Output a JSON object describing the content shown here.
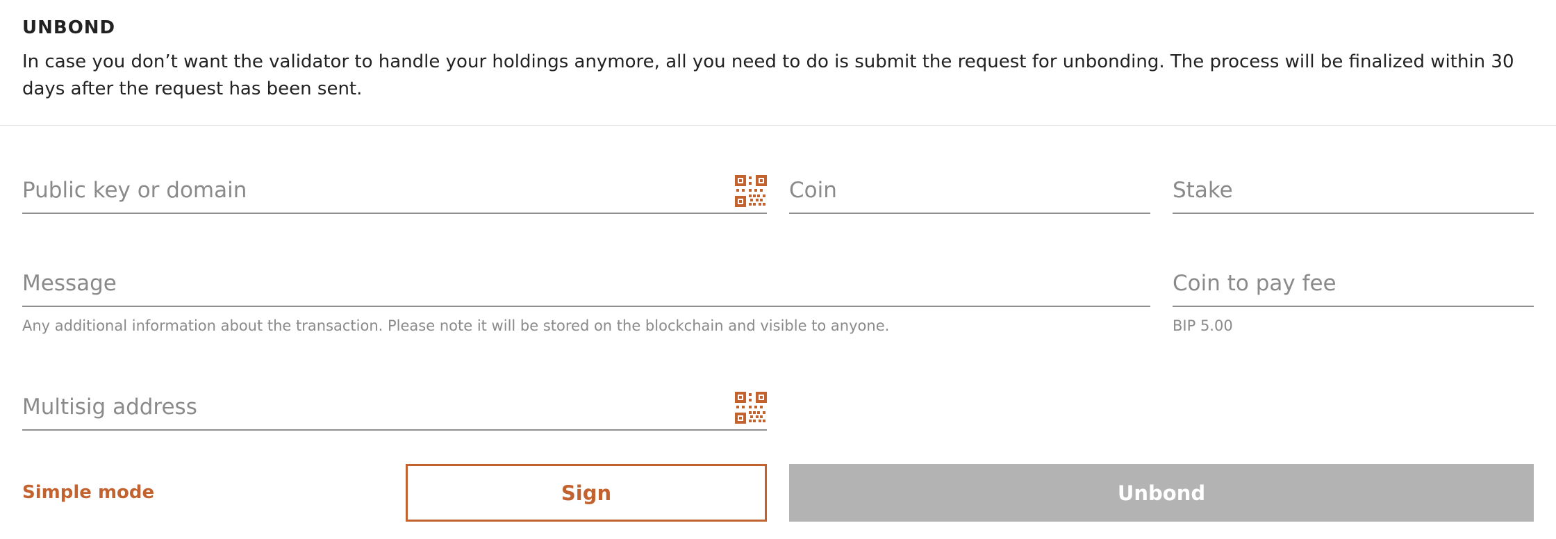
{
  "header": {
    "title": "UNBOND",
    "description": "In case you don’t want the validator to handle your holdings anymore, all you need to do is submit the request for unbonding. The process will be finalized within 30 days after the request has been sent."
  },
  "form": {
    "public_key": {
      "placeholder": "Public key or domain",
      "value": ""
    },
    "coin": {
      "placeholder": "Coin",
      "value": ""
    },
    "stake": {
      "placeholder": "Stake",
      "value": ""
    },
    "message": {
      "placeholder": "Message",
      "value": "",
      "hint": "Any additional information about the transaction. Please note it will be stored on the blockchain and visible to anyone."
    },
    "fee_coin": {
      "placeholder": "Coin to pay fee",
      "value": "",
      "hint": "BIP 5.00"
    },
    "multisig": {
      "placeholder": "Multisig address",
      "value": ""
    }
  },
  "actions": {
    "simple_mode_label": "Simple mode",
    "sign_label": "Sign",
    "unbond_label": "Unbond"
  },
  "colors": {
    "accent": "#c2622f",
    "disabled_button": "#b3b3b3",
    "placeholder": "#8a8a8a",
    "field_border": "#8f8f8f"
  },
  "icons": {
    "qr": "qr-code-icon"
  }
}
